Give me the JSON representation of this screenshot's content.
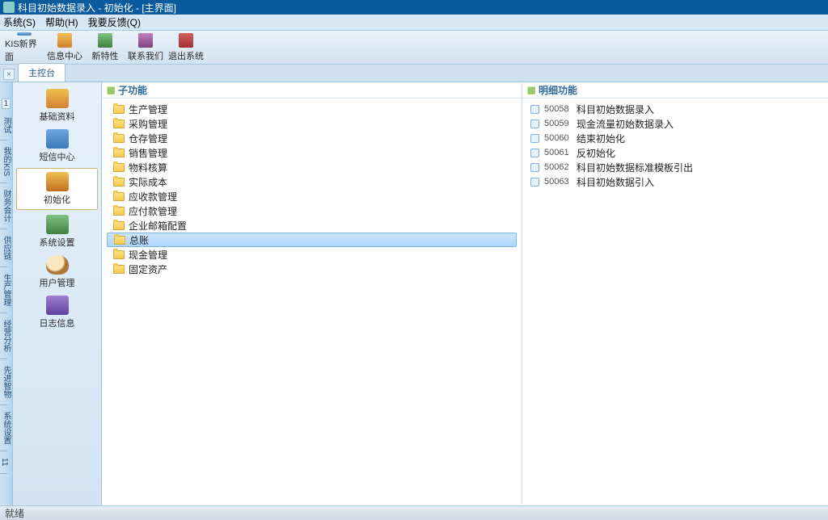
{
  "window": {
    "title": "科目初始数据录入 - 初始化 - [主界面]"
  },
  "menu": {
    "system": "系统(S)",
    "help": "帮助(H)",
    "feedback": "我要反馈(Q)"
  },
  "toolbar": {
    "home": "KIS新界面",
    "info": "信息中心",
    "new": "新特性",
    "contact": "联系我们",
    "exit": "退出系统"
  },
  "tab": {
    "main": "主控台"
  },
  "leftstrip": {
    "badge": "1",
    "items": [
      "测试",
      "我的KIS",
      "财务会计",
      "供应链",
      "生产管理",
      "经营分析",
      "先进智物",
      "系统设置",
      "11"
    ]
  },
  "nav": {
    "items": [
      {
        "label": "基础资料"
      },
      {
        "label": "短信中心"
      },
      {
        "label": "初始化",
        "selected": true
      },
      {
        "label": "系统设置"
      },
      {
        "label": "用户管理"
      },
      {
        "label": "日志信息"
      }
    ]
  },
  "subcol": {
    "title": "子功能",
    "items": [
      {
        "label": "生产管理"
      },
      {
        "label": "采购管理"
      },
      {
        "label": "仓存管理"
      },
      {
        "label": "销售管理"
      },
      {
        "label": "物料核算"
      },
      {
        "label": "实际成本"
      },
      {
        "label": "应收款管理"
      },
      {
        "label": "应付款管理"
      },
      {
        "label": "企业邮箱配置"
      },
      {
        "label": "总账",
        "selected": true
      },
      {
        "label": "现金管理"
      },
      {
        "label": "固定资产"
      }
    ]
  },
  "detailcol": {
    "title": "明细功能",
    "items": [
      {
        "code": "50058",
        "label": "科目初始数据录入"
      },
      {
        "code": "50059",
        "label": "现金流量初始数据录入"
      },
      {
        "code": "50060",
        "label": "结束初始化"
      },
      {
        "code": "50061",
        "label": "反初始化"
      },
      {
        "code": "50062",
        "label": "科目初始数据标准模板引出"
      },
      {
        "code": "50063",
        "label": "科目初始数据引入"
      }
    ]
  },
  "status": {
    "left": "就绪"
  }
}
